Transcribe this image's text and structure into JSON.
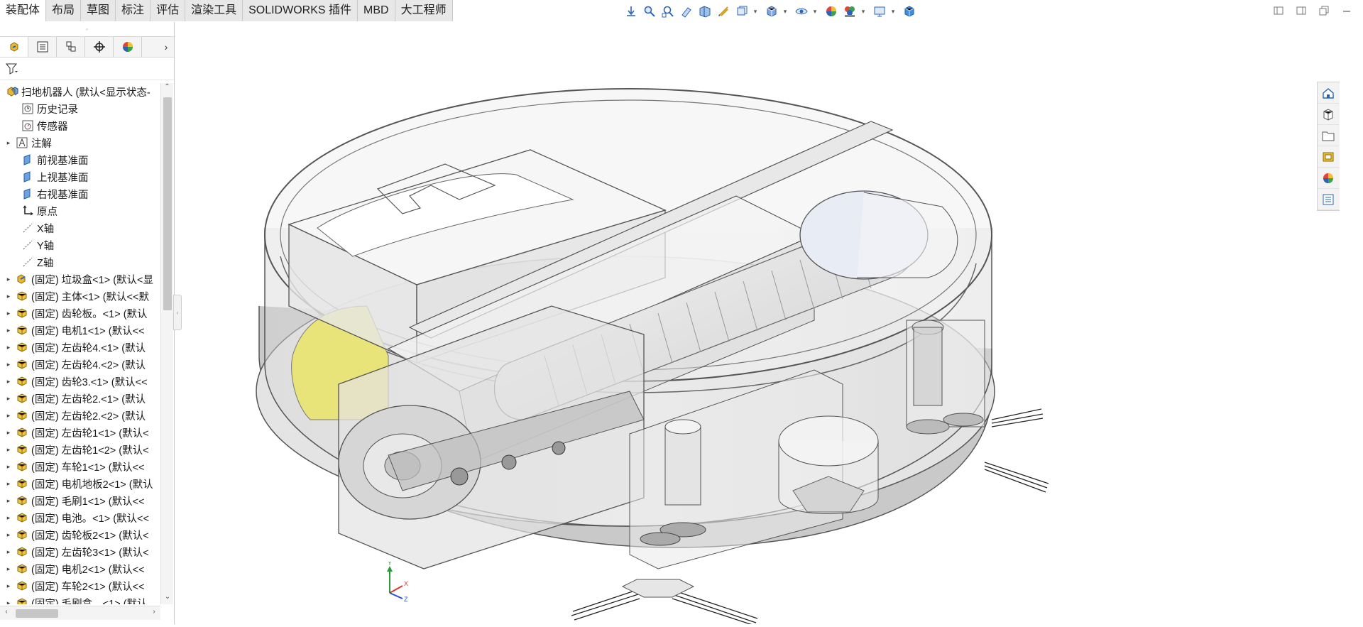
{
  "command_tabs": [
    "装配体",
    "布局",
    "草图",
    "标注",
    "评估",
    "渲染工具",
    "SOLIDWORKS 插件",
    "MBD",
    "大工程师"
  ],
  "active_tab": "装配体",
  "view_toolbar_icons": [
    "view-orientation-arrow-icon",
    "zoom-to-fit-icon",
    "zoom-to-area-icon",
    "previous-view-icon",
    "section-view-icon",
    "dynamic-annotation-icon",
    "view-type-icon",
    "display-style-icon",
    "hide-show-icon",
    "edit-appearance-icon",
    "apply-scene-icon",
    "view-settings-icon",
    "3d-box-icon"
  ],
  "window_icons": [
    "restore-left-icon",
    "restore-right-icon",
    "tile-windows-icon",
    "minimize-icon"
  ],
  "feature_manager": {
    "tabs": [
      "featuremanager-tree-icon",
      "propertymanager-icon",
      "configurationmanager-icon",
      "dimxpertmanager-icon",
      "displaymanager-icon"
    ],
    "filter_icon": "filter-icon",
    "tree": [
      {
        "label": "扫地机器人 (默认<显示状态-",
        "icon": "assembly",
        "level": 0,
        "expand": ""
      },
      {
        "label": "历史记录",
        "icon": "history",
        "level": 1,
        "expand": ""
      },
      {
        "label": "传感器",
        "icon": "sensor",
        "level": 1,
        "expand": ""
      },
      {
        "label": "注解",
        "icon": "annotation",
        "level": 1,
        "expand": "▸"
      },
      {
        "label": "前视基准面",
        "icon": "plane",
        "level": 1,
        "expand": ""
      },
      {
        "label": "上视基准面",
        "icon": "plane",
        "level": 1,
        "expand": ""
      },
      {
        "label": "右视基准面",
        "icon": "plane",
        "level": 1,
        "expand": ""
      },
      {
        "label": "原点",
        "icon": "origin",
        "level": 1,
        "expand": ""
      },
      {
        "label": "X轴",
        "icon": "axis",
        "level": 1,
        "expand": ""
      },
      {
        "label": "Y轴",
        "icon": "axis",
        "level": 1,
        "expand": ""
      },
      {
        "label": "Z轴",
        "icon": "axis",
        "level": 1,
        "expand": ""
      },
      {
        "label": "(固定) 垃圾盒<1> (默认<显",
        "icon": "subassembly",
        "level": 1,
        "expand": "▸"
      },
      {
        "label": "(固定) 主体<1> (默认<<默",
        "icon": "part",
        "level": 1,
        "expand": "▸"
      },
      {
        "label": "(固定) 齿轮板。<1> (默认",
        "icon": "part",
        "level": 1,
        "expand": "▸"
      },
      {
        "label": "(固定) 电机1<1> (默认<<",
        "icon": "part",
        "level": 1,
        "expand": "▸"
      },
      {
        "label": "(固定) 左齿轮4.<1> (默认",
        "icon": "part",
        "level": 1,
        "expand": "▸"
      },
      {
        "label": "(固定) 左齿轮4.<2> (默认",
        "icon": "part",
        "level": 1,
        "expand": "▸"
      },
      {
        "label": "(固定) 齿轮3.<1> (默认<<",
        "icon": "part",
        "level": 1,
        "expand": "▸"
      },
      {
        "label": "(固定) 左齿轮2.<1> (默认",
        "icon": "part",
        "level": 1,
        "expand": "▸"
      },
      {
        "label": "(固定) 左齿轮2.<2> (默认",
        "icon": "part",
        "level": 1,
        "expand": "▸"
      },
      {
        "label": "(固定) 左齿轮1<1> (默认<",
        "icon": "part",
        "level": 1,
        "expand": "▸"
      },
      {
        "label": "(固定) 左齿轮1<2> (默认<",
        "icon": "part",
        "level": 1,
        "expand": "▸"
      },
      {
        "label": "(固定) 车轮1<1> (默认<<",
        "icon": "part",
        "level": 1,
        "expand": "▸"
      },
      {
        "label": "(固定) 电机地板2<1> (默认",
        "icon": "part",
        "level": 1,
        "expand": "▸"
      },
      {
        "label": "(固定) 毛刷1<1> (默认<<",
        "icon": "part",
        "level": 1,
        "expand": "▸"
      },
      {
        "label": "(固定) 电池。<1> (默认<<",
        "icon": "part",
        "level": 1,
        "expand": "▸"
      },
      {
        "label": "(固定) 齿轮板2<1> (默认<",
        "icon": "part",
        "level": 1,
        "expand": "▸"
      },
      {
        "label": "(固定) 左齿轮3<1> (默认<",
        "icon": "part",
        "level": 1,
        "expand": "▸"
      },
      {
        "label": "(固定) 电机2<1> (默认<<",
        "icon": "part",
        "level": 1,
        "expand": "▸"
      },
      {
        "label": "(固定) 车轮2<1> (默认<<",
        "icon": "part",
        "level": 1,
        "expand": "▸"
      },
      {
        "label": "(固定) 毛刷盒。<1> (默认",
        "icon": "part",
        "level": 1,
        "expand": "▸"
      }
    ]
  },
  "task_pane_icons": [
    "solidworks-resources-icon",
    "design-library-icon",
    "file-explorer-icon",
    "view-palette-icon",
    "appearances-scenes-icon",
    "custom-properties-icon"
  ],
  "triad": {
    "x": "X",
    "y": "Y",
    "z": "Z"
  },
  "colors": {
    "accent": "#1f6fd1",
    "part_yellow": "#e8b830",
    "model_edge": "#555555",
    "yellow_panel": "#e9e47a"
  }
}
